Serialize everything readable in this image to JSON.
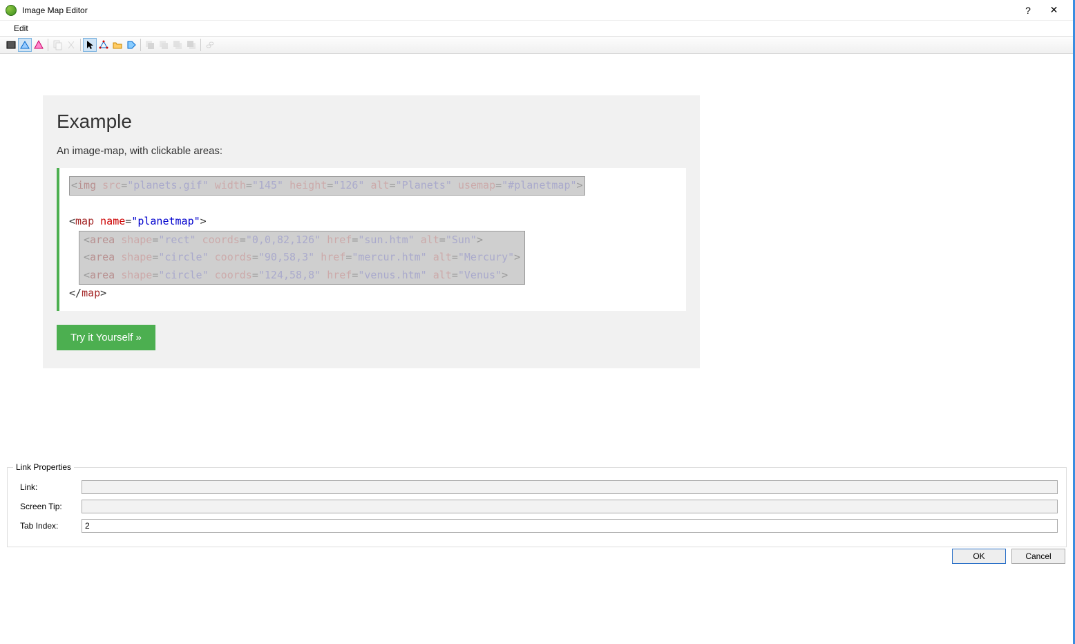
{
  "titlebar": {
    "title": "Image Map Editor"
  },
  "menubar": {
    "edit": "Edit"
  },
  "example": {
    "heading": "Example",
    "subtitle": "An image-map, with clickable areas:",
    "code": {
      "img_tag": "img",
      "img_attrs": [
        {
          "k": "src",
          "v": "\"planets.gif\""
        },
        {
          "k": "width",
          "v": "\"145\""
        },
        {
          "k": "height",
          "v": "\"126\""
        },
        {
          "k": "alt",
          "v": "\"Planets\""
        },
        {
          "k": "usemap",
          "v": "\"#planetmap\""
        }
      ],
      "map_open_tag": "map",
      "map_name_attr": "name",
      "map_name_val": "\"planetmap\"",
      "areas": [
        {
          "shape": "\"rect\"",
          "coords": "\"0,0,82,126\"",
          "href": "\"sun.htm\"",
          "alt": "\"Sun\""
        },
        {
          "shape": "\"circle\"",
          "coords": "\"90,58,3\"",
          "href": "\"mercur.htm\"",
          "alt": "\"Mercury\""
        },
        {
          "shape": "\"circle\"",
          "coords": "\"124,58,8\"",
          "href": "\"venus.htm\"",
          "alt": "\"Venus\""
        }
      ],
      "map_close": "map"
    },
    "try_button": "Try it Yourself »"
  },
  "link_props": {
    "legend": "Link Properties",
    "link_label": "Link:",
    "link_value": "",
    "tip_label": "Screen Tip:",
    "tip_value": "",
    "tab_label": "Tab Index:",
    "tab_value": "2"
  },
  "buttons": {
    "ok": "OK",
    "cancel": "Cancel"
  }
}
